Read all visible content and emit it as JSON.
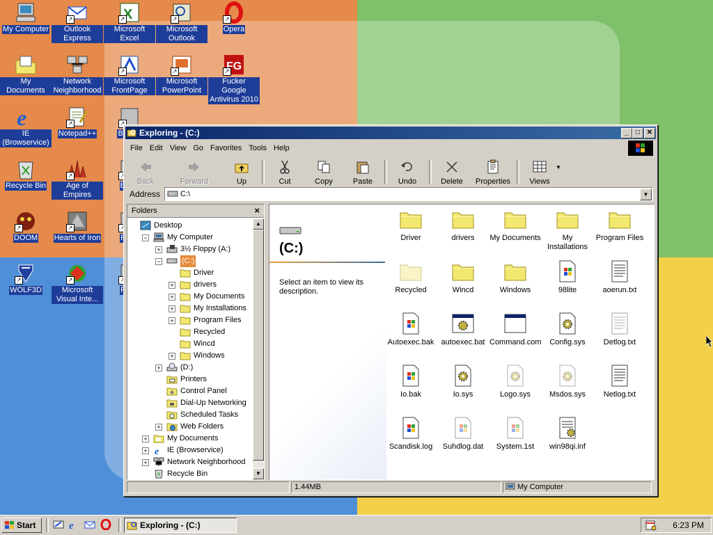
{
  "desktop": {
    "icons": [
      {
        "label": "My Computer",
        "icon": "my-computer-icon"
      },
      {
        "label": "Outlook Express",
        "icon": "outlook-express-icon"
      },
      {
        "label": "Microsoft Excel",
        "icon": "excel-icon"
      },
      {
        "label": "Microsoft Outlook",
        "icon": "outlook-icon"
      },
      {
        "label": "Opera",
        "icon": "opera-icon"
      },
      {
        "label": "My Documents",
        "icon": "my-documents-icon"
      },
      {
        "label": "Network Neighborhood",
        "icon": "network-neighborhood-icon"
      },
      {
        "label": "Microsoft FrontPage",
        "icon": "frontpage-icon"
      },
      {
        "label": "Microsoft PowerPoint",
        "icon": "powerpoint-icon"
      },
      {
        "label": "Fucker Google Antivirus 2010",
        "icon": "antivirus-icon"
      },
      {
        "label": "IE (Browservice)",
        "icon": "internet-explorer-icon"
      },
      {
        "label": "Notepad++",
        "icon": "notepad-plus-plus-icon"
      },
      {
        "label": "Bele D",
        "icon": "app-icon"
      },
      {
        "label": "Recycle Bin",
        "icon": "recycle-bin-icon"
      },
      {
        "label": "Age of Empires",
        "icon": "age-of-empires-icon"
      },
      {
        "label": "Big D",
        "icon": "app-icon"
      },
      {
        "label": "DOOM",
        "icon": "doom-icon"
      },
      {
        "label": "Hearts of Iron",
        "icon": "hearts-of-iron-icon"
      },
      {
        "label": "Pagg",
        "icon": "app-icon"
      },
      {
        "label": "WOLF3D",
        "icon": "wolf3d-icon"
      },
      {
        "label": "Microsoft Visual Inte...",
        "icon": "visual-interdev-icon"
      },
      {
        "label": "Pla Z",
        "icon": "app-icon"
      }
    ]
  },
  "window": {
    "title": "Exploring - (C:)",
    "minimize": "_",
    "maximize": "□",
    "close": "✕"
  },
  "menu": [
    "File",
    "Edit",
    "View",
    "Go",
    "Favorites",
    "Tools",
    "Help"
  ],
  "toolbar": {
    "back": "Back",
    "forward": "Forward",
    "up": "Up",
    "cut": "Cut",
    "copy": "Copy",
    "paste": "Paste",
    "undo": "Undo",
    "delete": "Delete",
    "properties": "Properties",
    "views": "Views"
  },
  "address": {
    "label": "Address",
    "value": "C:\\"
  },
  "folders": {
    "title": "Folders",
    "close": "×",
    "tree": [
      {
        "label": "Desktop",
        "depth": 0,
        "expander": "",
        "icon": "desktop-icon"
      },
      {
        "label": "My Computer",
        "depth": 1,
        "expander": "−",
        "icon": "my-computer-icon"
      },
      {
        "label": "3½ Floppy (A:)",
        "depth": 2,
        "expander": "+",
        "icon": "floppy-drive-icon"
      },
      {
        "label": "(C:)",
        "depth": 2,
        "expander": "−",
        "icon": "hard-drive-icon",
        "selected": true
      },
      {
        "label": "Driver",
        "depth": 3,
        "expander": "",
        "icon": "folder-icon"
      },
      {
        "label": "drivers",
        "depth": 3,
        "expander": "+",
        "icon": "folder-icon"
      },
      {
        "label": "My Documents",
        "depth": 3,
        "expander": "+",
        "icon": "folder-icon"
      },
      {
        "label": "My Installations",
        "depth": 3,
        "expander": "+",
        "icon": "folder-icon"
      },
      {
        "label": "Program Files",
        "depth": 3,
        "expander": "+",
        "icon": "folder-icon"
      },
      {
        "label": "Recycled",
        "depth": 3,
        "expander": "",
        "icon": "folder-icon"
      },
      {
        "label": "Wincd",
        "depth": 3,
        "expander": "",
        "icon": "folder-icon"
      },
      {
        "label": "Windows",
        "depth": 3,
        "expander": "+",
        "icon": "folder-icon"
      },
      {
        "label": "(D:)",
        "depth": 2,
        "expander": "+",
        "icon": "cd-drive-icon"
      },
      {
        "label": "Printers",
        "depth": 2,
        "expander": "",
        "icon": "printers-icon"
      },
      {
        "label": "Control Panel",
        "depth": 2,
        "expander": "",
        "icon": "control-panel-icon"
      },
      {
        "label": "Dial-Up Networking",
        "depth": 2,
        "expander": "",
        "icon": "dial-up-icon"
      },
      {
        "label": "Scheduled Tasks",
        "depth": 2,
        "expander": "",
        "icon": "scheduled-tasks-icon"
      },
      {
        "label": "Web Folders",
        "depth": 2,
        "expander": "+",
        "icon": "web-folders-icon"
      },
      {
        "label": "My Documents",
        "depth": 1,
        "expander": "+",
        "icon": "my-documents-icon"
      },
      {
        "label": "IE (Browservice)",
        "depth": 1,
        "expander": "+",
        "icon": "internet-explorer-icon"
      },
      {
        "label": "Network Neighborhood",
        "depth": 1,
        "expander": "+",
        "icon": "network-neighborhood-icon"
      },
      {
        "label": "Recycle Bin",
        "depth": 1,
        "expander": "",
        "icon": "recycle-bin-icon"
      }
    ]
  },
  "webview": {
    "drive_title": "(C:)",
    "description": "Select an item to view its description."
  },
  "files": [
    {
      "name": "Driver",
      "type": "folder"
    },
    {
      "name": "drivers",
      "type": "folder"
    },
    {
      "name": "My Documents",
      "type": "folder"
    },
    {
      "name": "My Installations",
      "type": "folder"
    },
    {
      "name": "Program Files",
      "type": "folder"
    },
    {
      "name": "Recycled",
      "type": "folder-hidden"
    },
    {
      "name": "Wincd",
      "type": "folder"
    },
    {
      "name": "Windows",
      "type": "folder"
    },
    {
      "name": "98lite",
      "type": "batch"
    },
    {
      "name": "aoerun.txt",
      "type": "text"
    },
    {
      "name": "Autoexec.bak",
      "type": "batch"
    },
    {
      "name": "autoexec.bat",
      "type": "window-gear"
    },
    {
      "name": "Command.com",
      "type": "window"
    },
    {
      "name": "Config.sys",
      "type": "gear"
    },
    {
      "name": "Detlog.txt",
      "type": "text-hidden"
    },
    {
      "name": "Io.bak",
      "type": "batch"
    },
    {
      "name": "Io.sys",
      "type": "gear"
    },
    {
      "name": "Logo.sys",
      "type": "gear-hidden"
    },
    {
      "name": "Msdos.sys",
      "type": "gear-hidden"
    },
    {
      "name": "Netlog.txt",
      "type": "text"
    },
    {
      "name": "Scandisk.log",
      "type": "batch"
    },
    {
      "name": "Suhdlog.dat",
      "type": "batch-hidden"
    },
    {
      "name": "System.1st",
      "type": "batch-hidden"
    },
    {
      "name": "win98qi.inf",
      "type": "inf"
    }
  ],
  "status": {
    "size": "1.44MB",
    "zone": "My Computer"
  },
  "taskbar": {
    "start": "Start",
    "task": "Exploring - (C:)",
    "clock": "6:23 PM"
  },
  "colors": {
    "title_active": "#0a246a",
    "selection": "#e58a3a",
    "desktop_orange": "#e58a4a",
    "desktop_green": "#7fc06a",
    "desktop_blue": "#4f8fd8",
    "desktop_yellow": "#f2d04a"
  }
}
